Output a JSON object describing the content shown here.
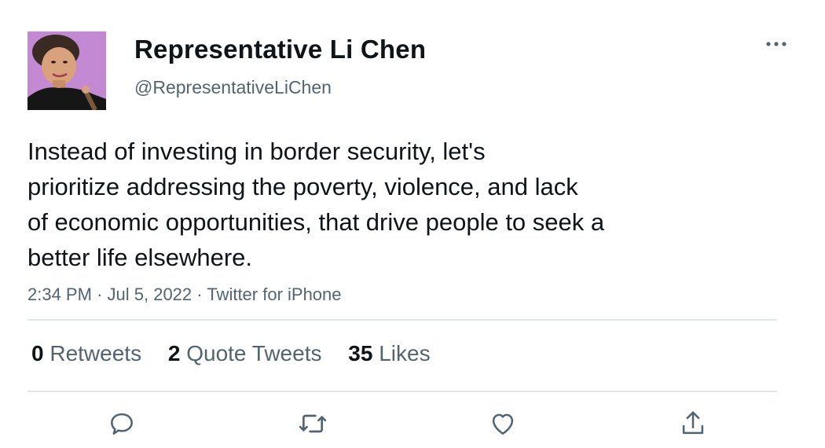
{
  "author": {
    "display_name": "Representative Li Chen",
    "handle": "@RepresentativeLiChen",
    "avatar_icon": "profile-photo"
  },
  "tweet": {
    "text_lines": [
      "Instead of investing in border security, let's",
      "prioritize addressing the poverty, violence, and lack",
      "of economic opportunities, that drive people to seek a",
      "better life elsewhere."
    ],
    "time": "2:34 PM",
    "separator": "·",
    "date": "Jul 5, 2022",
    "source": "Twitter for iPhone"
  },
  "stats": {
    "retweets": {
      "count": "0",
      "label": "Retweets"
    },
    "quote_tweets": {
      "count": "2",
      "label": "Quote Tweets"
    },
    "likes": {
      "count": "35",
      "label": "Likes"
    }
  },
  "actions": [
    {
      "name": "reply",
      "icon": "reply-icon"
    },
    {
      "name": "retweet",
      "icon": "retweet-icon"
    },
    {
      "name": "like",
      "icon": "heart-icon"
    },
    {
      "name": "share",
      "icon": "share-icon"
    }
  ],
  "colors": {
    "text_primary": "#0f1419",
    "text_secondary": "#536471",
    "icon": "#536471",
    "divider": "#e1e6ea",
    "avatar_background": "#c98fd8"
  }
}
